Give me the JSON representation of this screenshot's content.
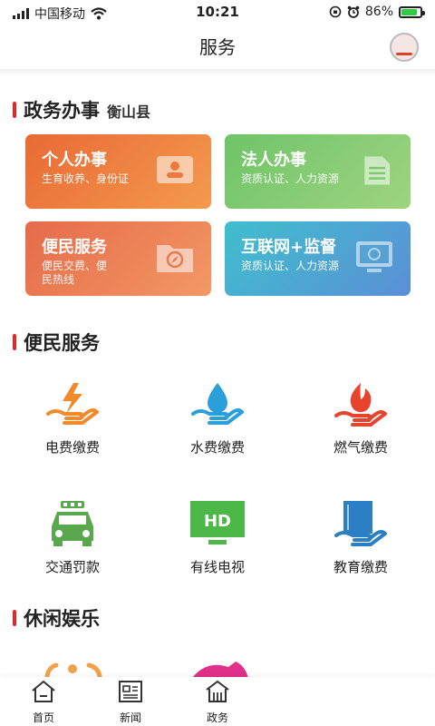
{
  "status_bar": {
    "carrier": "中国移动",
    "time": "10:21",
    "battery": "86%",
    "battery_level": 0.86
  },
  "header": {
    "title": "服务"
  },
  "gov_section": {
    "title": "政务办事",
    "location": "衡山县",
    "cards": [
      {
        "title": "个人办事",
        "desc": "生育收养、身份证",
        "icon": "id-card-icon"
      },
      {
        "title": "法人办事",
        "desc": "资质认证、人力资源",
        "icon": "document-icon"
      },
      {
        "title": "便民服务",
        "desc": "便民交费、便民热线",
        "icon": "compass-folder-icon"
      },
      {
        "title": "互联网+监督",
        "desc": "资质认证、人力资源",
        "icon": "monitor-icon"
      }
    ]
  },
  "service_section": {
    "title": "便民服务",
    "items": [
      {
        "label": "电费缴费",
        "icon": "electricity-icon"
      },
      {
        "label": "水费缴费",
        "icon": "water-icon"
      },
      {
        "label": "燃气缴费",
        "icon": "gas-flame-icon"
      },
      {
        "label": "交通罚款",
        "icon": "car-icon"
      },
      {
        "label": "有线电视",
        "icon": "hd-tv-icon"
      },
      {
        "label": "教育缴费",
        "icon": "book-icon"
      }
    ]
  },
  "leisure_section": {
    "title": "休闲娱乐"
  },
  "tabbar": {
    "tabs": [
      {
        "label": "首页",
        "icon": "home-icon"
      },
      {
        "label": "新闻",
        "icon": "news-icon"
      },
      {
        "label": "政务",
        "icon": "government-icon"
      }
    ]
  },
  "colors": {
    "accent_red": "#e02a2a",
    "card_orange": "#e86a35",
    "card_green": "#6fc468",
    "card_blue": "#3fbfcd"
  }
}
